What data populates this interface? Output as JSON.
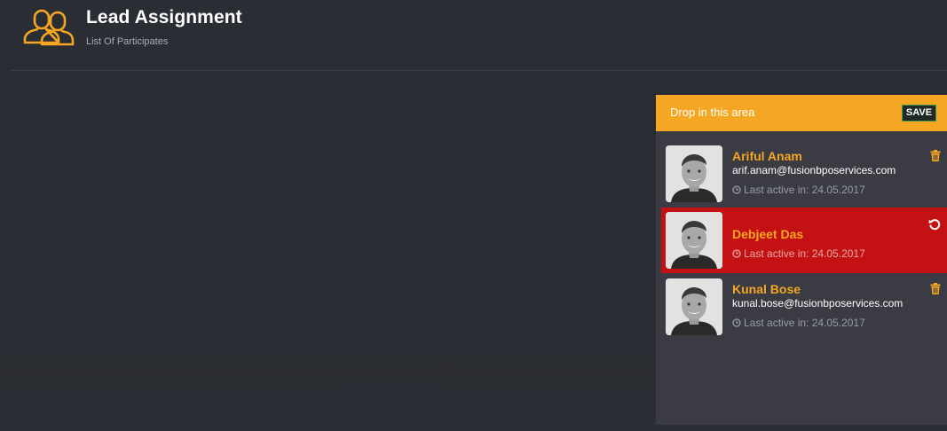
{
  "header": {
    "title": "Lead Assignment",
    "subtitle": "List Of Participates",
    "icon": "users-outline-icon"
  },
  "colors": {
    "accent": "#f5a623",
    "removed_card": "#c41214",
    "panel": "#3a3b43",
    "background": "#2b2d35"
  },
  "drop_area": {
    "label": "Drop in this area",
    "save_label": "SAVE"
  },
  "participants": [
    {
      "name": "Ariful Anam",
      "email": "arif.anam@fusionbposervices.com",
      "last_active": "Last active in: 24.05.2017",
      "state": "assigned",
      "action_icon": "trash-icon"
    },
    {
      "name": "Debjeet Das",
      "email": "",
      "last_active": "Last active in: 24.05.2017",
      "state": "removed",
      "action_icon": "undo-icon"
    },
    {
      "name": "Kunal Bose",
      "email": "kunal.bose@fusionbposervices.com",
      "last_active": "Last active in: 24.05.2017",
      "state": "assigned",
      "action_icon": "trash-icon"
    }
  ]
}
